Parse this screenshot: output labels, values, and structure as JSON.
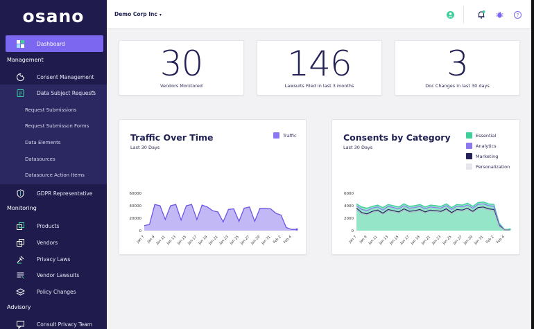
{
  "brand": {
    "logo": "osano"
  },
  "sidebar": {
    "dashboard": "Dashboard",
    "management": "Management",
    "consent_management": "Consent Management",
    "data_subject_requests": "Data Subject Requests",
    "sub_items": [
      "Request Submissions",
      "Request Submisson Forms",
      "Data Elements",
      "Datasources",
      "Datasource Action Items"
    ],
    "gdpr_rep": "GDPR Representative",
    "monitoring": "Monitoring",
    "products": "Products",
    "vendors": "Vendors",
    "privacy_laws": "Privacy Laws",
    "vendor_lawsuits": "Vendor Lawsuits",
    "policy_changes": "Policy Changes",
    "advisory": "Advisory",
    "consult": "Consult Privacy Team"
  },
  "topbar": {
    "org": "Demo Corp Inc",
    "caret": "▾"
  },
  "stats": [
    {
      "value": "30",
      "label": "Vendors Monitored"
    },
    {
      "value": "146",
      "label": "Lawsuits Filed in last 3 months"
    },
    {
      "value": "3",
      "label": "Doc Changes in last 30 days"
    }
  ],
  "traffic": {
    "title": "Traffic Over Time",
    "subtitle": "Last 30 Days",
    "legend": "Traffic"
  },
  "consents": {
    "title": "Consents by Category",
    "subtitle": "Last 30 Days",
    "legend": [
      "Essential",
      "Analytics",
      "Marketing",
      "Personalization"
    ]
  },
  "colors": {
    "sidebar": "#1f1b4d",
    "accent": "#7b67f0",
    "traffic_fill": "#c2b8f6",
    "traffic_line": "#6a56e6",
    "essential": "#3ecf9a",
    "analytics": "#8c78f2",
    "marketing": "#24205a",
    "personalization": "#e6e6ee"
  },
  "chart_data": [
    {
      "type": "area",
      "title": "Traffic Over Time",
      "x": [
        "Jan 7",
        "Jan 8",
        "Jan 9",
        "Jan 10",
        "Jan 11",
        "Jan 12",
        "Jan 13",
        "Jan 14",
        "Jan 15",
        "Jan 16",
        "Jan 17",
        "Jan 18",
        "Jan 19",
        "Jan 20",
        "Jan 21",
        "Jan 22",
        "Jan 23",
        "Jan 24",
        "Jan 25",
        "Jan 26",
        "Jan 27",
        "Jan 28",
        "Jan 29",
        "Jan 30",
        "Jan 31",
        "Feb 1",
        "Feb 2",
        "Feb 3",
        "Feb 4",
        "Feb 5"
      ],
      "tick_labels": [
        "Jan 7",
        "Jan 9",
        "Jan 11",
        "Jan 13",
        "Jan 15",
        "Jan 17",
        "Jan 19",
        "Jan 21",
        "Jan 23",
        "Jan 25",
        "Jan 27",
        "Jan 29",
        "Jan 31",
        "Feb 2",
        "Feb 4"
      ],
      "series": [
        {
          "name": "Traffic",
          "values": [
            8000,
            10000,
            42000,
            40000,
            18000,
            40000,
            42000,
            17000,
            40000,
            42000,
            18000,
            41000,
            38000,
            32000,
            30000,
            14000,
            34000,
            35000,
            15000,
            36000,
            38000,
            15000,
            36000,
            36000,
            35000,
            28000,
            25000,
            5000,
            2000,
            2000
          ]
        }
      ],
      "yticks": [
        0,
        20000,
        40000,
        60000
      ],
      "ylim": [
        0,
        60000
      ]
    },
    {
      "type": "area",
      "title": "Consents by Category",
      "x": [
        "Jan 7",
        "Jan 8",
        "Jan 9",
        "Jan 10",
        "Jan 11",
        "Jan 12",
        "Jan 13",
        "Jan 14",
        "Jan 15",
        "Jan 16",
        "Jan 17",
        "Jan 18",
        "Jan 19",
        "Jan 20",
        "Jan 21",
        "Jan 22",
        "Jan 23",
        "Jan 24",
        "Jan 25",
        "Jan 26",
        "Jan 27",
        "Jan 28",
        "Jan 29",
        "Jan 30",
        "Jan 31",
        "Feb 1",
        "Feb 2",
        "Feb 3",
        "Feb 4",
        "Feb 5"
      ],
      "tick_labels": [
        "Jan 7",
        "Jan 9",
        "Jan 11",
        "Jan 13",
        "Jan 15",
        "Jan 17",
        "Jan 19",
        "Jan 21",
        "Jan 23",
        "Jan 25",
        "Jan 27",
        "Jan 29",
        "Jan 31",
        "Feb 2",
        "Feb 4"
      ],
      "series": [
        {
          "name": "Essential",
          "values": [
            4300,
            3800,
            3600,
            3900,
            4100,
            3700,
            4200,
            4000,
            3800,
            4300,
            3900,
            4000,
            4200,
            3800,
            4100,
            4000,
            3900,
            4300,
            3700,
            4200,
            4100,
            4400,
            3900,
            4500,
            4600,
            4300,
            4200,
            1200,
            200,
            200
          ]
        },
        {
          "name": "Analytics",
          "values": [
            4000,
            3400,
            3200,
            3600,
            3800,
            3300,
            3900,
            3700,
            3500,
            4000,
            3600,
            3700,
            3900,
            3500,
            3800,
            3700,
            3600,
            4000,
            3400,
            3900,
            3800,
            4100,
            3600,
            4200,
            4300,
            4000,
            3900,
            1000,
            150,
            150
          ]
        },
        {
          "name": "Marketing",
          "values": [
            3600,
            2900,
            2700,
            3100,
            3300,
            2800,
            3400,
            3200,
            3000,
            3500,
            3100,
            3200,
            3400,
            3000,
            3300,
            3200,
            3100,
            3500,
            2900,
            3400,
            3300,
            3600,
            3100,
            3700,
            3800,
            3500,
            3400,
            800,
            100,
            100
          ]
        },
        {
          "name": "Personalization",
          "values": [
            3300,
            2700,
            2500,
            2900,
            3100,
            2600,
            3200,
            3000,
            2800,
            3300,
            2900,
            3000,
            3200,
            2800,
            3100,
            3000,
            2900,
            3300,
            2700,
            3200,
            3100,
            3400,
            2900,
            3500,
            3600,
            3300,
            3200,
            700,
            100,
            100
          ]
        }
      ],
      "yticks": [
        0,
        2000,
        4000,
        6000
      ],
      "ylim": [
        0,
        6000
      ]
    }
  ]
}
